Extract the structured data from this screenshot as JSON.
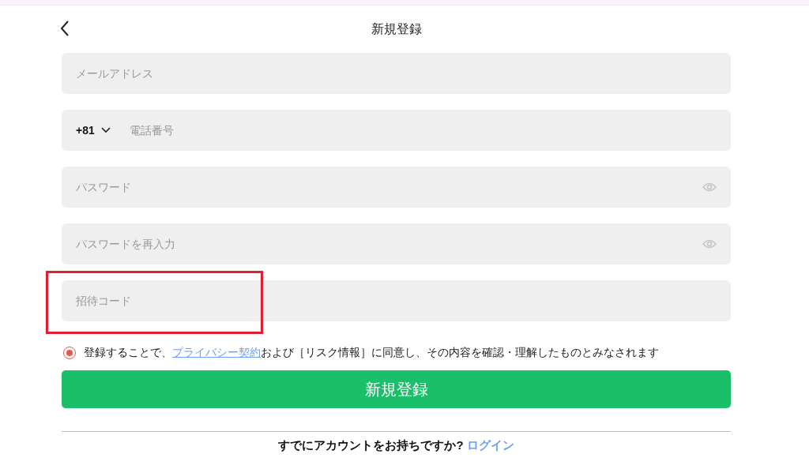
{
  "header": {
    "title": "新規登録"
  },
  "fields": [
    {
      "kind": "text",
      "placeholder": "メールアドレス",
      "highlighted": false
    },
    {
      "kind": "phone",
      "country_code": "+81",
      "placeholder": "電話番号",
      "highlighted": false
    },
    {
      "kind": "password",
      "placeholder": "パスワード",
      "highlighted": false
    },
    {
      "kind": "password",
      "placeholder": "パスワードを再入力",
      "highlighted": false
    },
    {
      "kind": "text",
      "placeholder": "招待コード",
      "highlighted": true
    }
  ],
  "consent": {
    "checked": true,
    "before": "登録することで、",
    "link": "プライバシー契約",
    "after": "および［リスク情報］に同意し、その内容を確認・理解したものとみなされます"
  },
  "submit": "新規登録",
  "footer": {
    "question": "すでにアカウントをお持ちですか?",
    "link": "ログイン"
  }
}
